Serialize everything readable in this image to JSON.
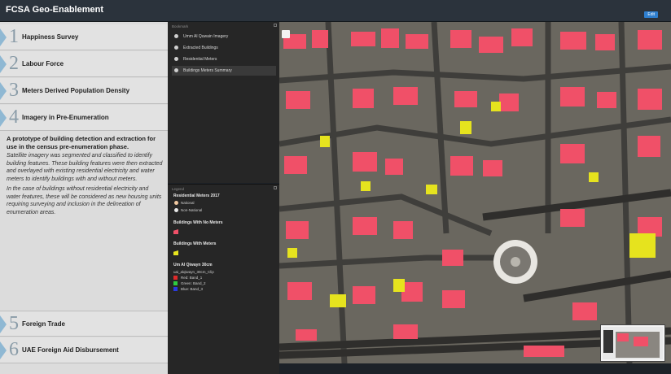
{
  "header": {
    "title": "FCSA Geo-Enablement",
    "edit_label": "Edit"
  },
  "accordion": [
    {
      "num": "1",
      "label": "Happiness Survey"
    },
    {
      "num": "2",
      "label": "Labour Force"
    },
    {
      "num": "3",
      "label": "Meters Derived Population Density"
    },
    {
      "num": "4",
      "label": "Imagery in Pre-Enumeration"
    },
    {
      "num": "5",
      "label": "Foreign Trade"
    },
    {
      "num": "6",
      "label": "UAE Foreign Aid Disbursement"
    }
  ],
  "description": {
    "heading": "A prototype of building detection and extraction for use in the census pre-enumeration phase.",
    "para1": "Satellite imagery was segmented and classified to identify building features. These building features were then extracted and overlayed with existing residential electricity and water meters to identify buildings with and without meters.",
    "para2": "In the case of buildings without residential electricity and water features, these will be considered as new housing units requiring surveying and inclusion in the delineation of enumeration areas."
  },
  "bookmark": {
    "title": "Bookmark",
    "items": [
      "Umm Al Quwain Imagery",
      "Extracted Buildings",
      "Residential Meters",
      "Buildings Meters Summary"
    ]
  },
  "legend": {
    "title": "Legend",
    "meters_title": "Residential Meters 2017",
    "national": "National",
    "non_national": "Non-National",
    "no_meters_title": "Buildings With No Meters",
    "with_meters_title": "Buildings With Meters",
    "raster_title": "Um Al Qiwayn 30cm",
    "raster_layer": "uai_alqiwayn_30cm_Clip",
    "red": "Red: Band_1",
    "green": "Green: Band_2",
    "blue": "Blue: Band_3"
  },
  "colors": {
    "no_meters": "#f05068",
    "with_meters": "#e6e31e",
    "national": "#f0c8a0",
    "non_national": "#e8e8e8"
  },
  "icons": {
    "zoom": "zoom-control-icon",
    "overview": "overview-map-icon"
  }
}
